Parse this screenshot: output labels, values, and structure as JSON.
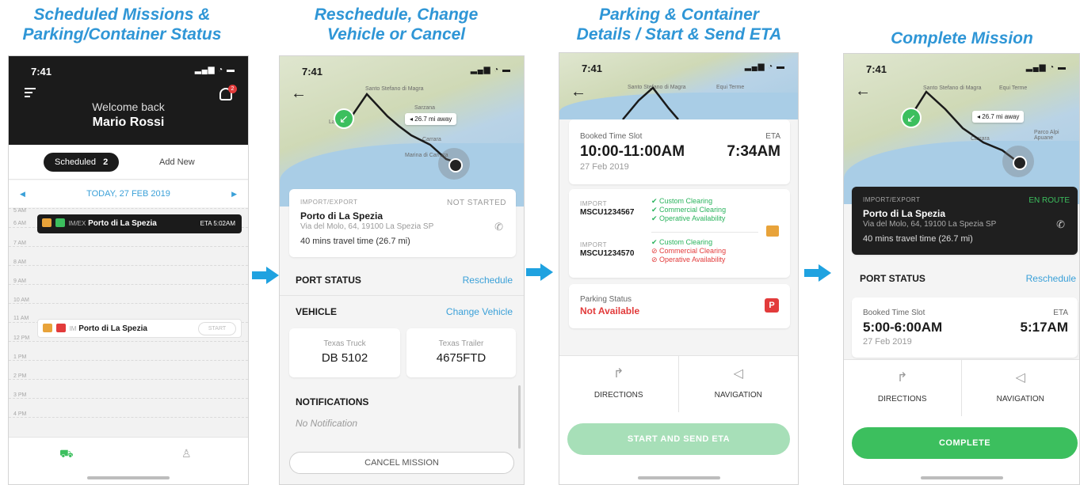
{
  "captions": [
    "Scheduled Missions & Parking/Container Status",
    "Reschedule, Change Vehicle or Cancel",
    "Parking & Container Details / Start & Send ETA",
    "Complete Mission"
  ],
  "caption_lines": [
    [
      "Scheduled Missions &",
      "Parking/Container Status"
    ],
    [
      "Reschedule, Change",
      "Vehicle or Cancel"
    ],
    [
      "Parking & Container",
      "Details / Start & Send ETA"
    ],
    [
      "Complete Mission"
    ]
  ],
  "colors": {
    "caption": "#2f96d6",
    "arrow": "#1fa2e0",
    "green": "#3cbf5e",
    "red": "#e23b3b",
    "link": "#3aa0d8"
  },
  "status_time": "7:41",
  "phone1": {
    "welcome": "Welcome back",
    "user_name": "Mario Rossi",
    "notification_count": "2",
    "tab_scheduled": "Scheduled",
    "tab_scheduled_count": "2",
    "tab_add_new": "Add New",
    "date": "TODAY, 27 FEB 2019",
    "hours": [
      "5 AM",
      "6 AM",
      "7 AM",
      "8 AM",
      "9 AM",
      "10 AM",
      "11 AM",
      "12 PM",
      "1 PM",
      "2 PM",
      "3 PM",
      "4 PM"
    ],
    "event1": {
      "type": "IM/EX",
      "place": "Porto di La Spezia",
      "eta": "ETA 5:02AM"
    },
    "event2": {
      "type": "IM",
      "place": "Porto di La Spezia",
      "action": "START"
    },
    "icons": [
      "menu-icon",
      "bell-icon",
      "truck-icon",
      "user-icon"
    ]
  },
  "phone2": {
    "distance": "26.7 mi away",
    "card_type": "IMPORT/EXPORT",
    "card_status": "NOT STARTED",
    "place": "Porto di La Spezia",
    "address": "Via del Molo, 64, 19100 La Spezia SP",
    "travel": "40 mins travel time (26.7 mi)",
    "port_status": "PORT STATUS",
    "reschedule": "Reschedule",
    "vehicle": "VEHICLE",
    "change_vehicle": "Change Vehicle",
    "truck_label": "Texas Truck",
    "truck_value": "DB 5102",
    "trailer_label": "Texas Trailer",
    "trailer_value": "4675FTD",
    "notifications": "NOTIFICATIONS",
    "no_notification": "No Notification",
    "cancel": "CANCEL MISSION"
  },
  "phone3": {
    "slot_label": "Booked Time Slot",
    "eta_label": "ETA",
    "slot_time": "10:00-11:00AM",
    "eta_time": "7:34AM",
    "slot_date": "27 Feb 2019",
    "containers": [
      {
        "type": "IMPORT",
        "id": "MSCU1234567",
        "checks": [
          {
            "label": "Custom Clearing",
            "ok": true
          },
          {
            "label": "Commercial Clearing",
            "ok": true
          },
          {
            "label": "Operative Availability",
            "ok": true
          }
        ]
      },
      {
        "type": "IMPORT",
        "id": "MSCU1234570",
        "checks": [
          {
            "label": "Custom Clearing",
            "ok": true
          },
          {
            "label": "Commercial Clearing",
            "ok": false
          },
          {
            "label": "Operative Availability",
            "ok": false
          }
        ]
      }
    ],
    "parking_label": "Parking Status",
    "parking_value": "Not Available",
    "directions": "DIRECTIONS",
    "navigation": "NAVIGATION",
    "start": "START AND SEND ETA"
  },
  "phone4": {
    "distance": "26.7 mi away",
    "card_type": "IMPORT/EXPORT",
    "card_status": "EN ROUTE",
    "place": "Porto di La Spezia",
    "address": "Via del Molo, 64, 19100 La Spezia SP",
    "travel": "40 mins travel time (26.7 mi)",
    "port_status": "PORT STATUS",
    "reschedule": "Reschedule",
    "slot_label": "Booked Time Slot",
    "eta_label": "ETA",
    "slot_time": "5:00-6:00AM",
    "eta_time": "5:17AM",
    "slot_date": "27 Feb 2019",
    "directions": "DIRECTIONS",
    "navigation": "NAVIGATION",
    "complete": "COMPLETE"
  }
}
